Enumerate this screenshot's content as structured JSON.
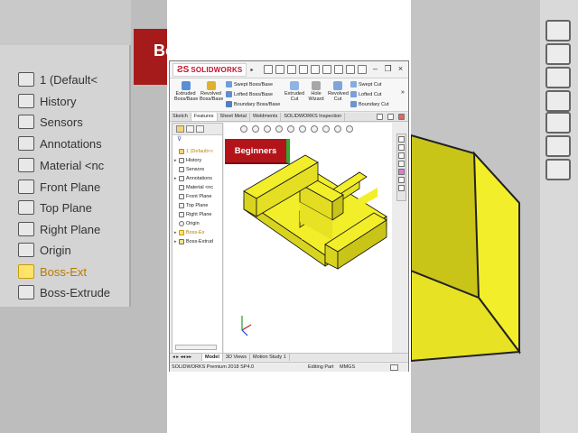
{
  "background_left": {
    "tree": [
      {
        "label": "1  (Default<",
        "icon": "part-icon"
      },
      {
        "label": "History",
        "icon": "history-icon"
      },
      {
        "label": "Sensors",
        "icon": "sensors-icon"
      },
      {
        "label": "Annotations",
        "icon": "annotations-icon"
      },
      {
        "label": "Material <nc",
        "icon": "material-icon"
      },
      {
        "label": "Front Plane",
        "icon": "plane-icon"
      },
      {
        "label": "Top Plane",
        "icon": "plane-icon"
      },
      {
        "label": "Right Plane",
        "icon": "plane-icon"
      },
      {
        "label": "Origin",
        "icon": "origin-icon"
      },
      {
        "label": "Boss-Ext",
        "icon": "warning-icon"
      },
      {
        "label": "Boss-Extrude",
        "icon": "extrude-icon"
      }
    ],
    "badge_fragment": "Bo"
  },
  "window": {
    "brand": "SOLIDWORKS",
    "close_glyph": "×",
    "restore_glyph": "❐",
    "minimize_glyph": "–"
  },
  "ribbon": {
    "extruded_boss": "Extruded Boss/Base",
    "revolved_boss": "Revolved Boss/Base",
    "swept_boss": "Swept Boss/Base",
    "lofted_boss": "Lofted Boss/Base",
    "boundary_boss": "Boundary Boss/Base",
    "extruded_cut": "Extruded Cut",
    "hole_wizard": "Hole Wizard",
    "revolved_cut": "Revolved Cut",
    "swept_cut": "Swept Cut",
    "lofted_cut": "Lofted Cut",
    "boundary_cut": "Boundary Cut",
    "more": "»"
  },
  "command_tabs": [
    "Sketch",
    "Features",
    "Sheet Metal",
    "Weldments",
    "SOLIDWORKS Inspection"
  ],
  "active_command_tab": "Features",
  "feature_tree": [
    {
      "label": "1  (Default<<",
      "icon": "part-icon",
      "arrow": ""
    },
    {
      "label": "History",
      "icon": "history-icon",
      "arrow": "▸"
    },
    {
      "label": "Sensors",
      "icon": "sensors-icon",
      "arrow": ""
    },
    {
      "label": "Annotations",
      "icon": "annotations-icon",
      "arrow": "▸"
    },
    {
      "label": "Material <nc",
      "icon": "material-icon",
      "arrow": ""
    },
    {
      "label": "Front Plane",
      "icon": "plane-icon",
      "arrow": ""
    },
    {
      "label": "Top Plane",
      "icon": "plane-icon",
      "arrow": ""
    },
    {
      "label": "Right Plane",
      "icon": "plane-icon",
      "arrow": ""
    },
    {
      "label": "Origin",
      "icon": "origin-icon",
      "arrow": ""
    },
    {
      "label": "Boss-Ex",
      "icon": "warning-icon",
      "arrow": "▸"
    },
    {
      "label": "Boss-Extrud",
      "icon": "extrude-icon",
      "arrow": "▸"
    }
  ],
  "badge": {
    "label": "Beginners"
  },
  "bottom_tabs": [
    "Model",
    "3D Views",
    "Motion Study 1"
  ],
  "active_bottom_tab": "Model",
  "status": {
    "product": "SOLIDWORKS Premium 2018 SP4.0",
    "mode": "Editing Part",
    "units": "MMGS"
  },
  "colors": {
    "model_yellow": "#f2ee2a",
    "model_shade": "#c9c418",
    "badge_red": "#b3141a",
    "badge_accent": "#2fa82f",
    "brand_red": "#c8102e"
  }
}
